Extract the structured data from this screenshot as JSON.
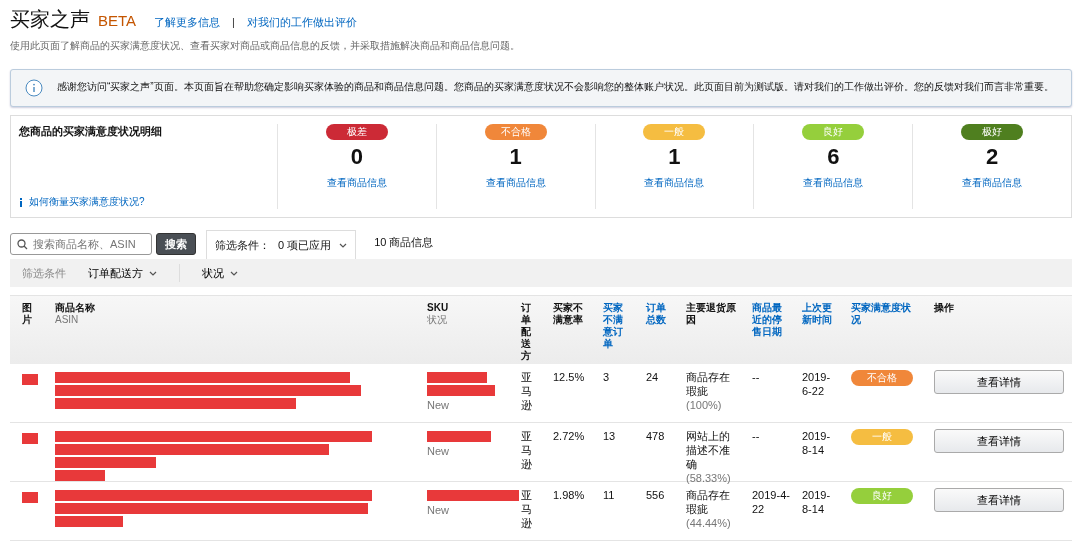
{
  "header": {
    "title": "买家之声",
    "badge": "BETA",
    "links": [
      "了解更多信息",
      "对我们的工作做出评价"
    ],
    "separator": "|",
    "subtitle": "使用此页面了解商品的买家满意度状况、查看买家对商品或商品信息的反馈，并采取措施解决商品和商品信息问题。"
  },
  "notice": {
    "text": "感谢您访问“买家之声”页面。本页面旨在帮助您确定影响买家体验的商品和商品信息问题。您商品的买家满意度状况不会影响您的整体账户状况。此页面目前为测试版。请对我们的工作做出评价。您的反馈对我们而言非常重要。"
  },
  "summary": {
    "title": "您商品的买家满意度状况明细",
    "help_link": "如何衡量买家满意度状况?",
    "levels": [
      {
        "label": "极差",
        "color": "#cc2a36",
        "count": "0",
        "link": "查看商品信息"
      },
      {
        "label": "不合格",
        "color": "#f0873a",
        "count": "1",
        "link": "查看商品信息"
      },
      {
        "label": "一般",
        "color": "#f5bd41",
        "count": "1",
        "link": "查看商品信息"
      },
      {
        "label": "良好",
        "color": "#95cf3c",
        "count": "6",
        "link": "查看商品信息"
      },
      {
        "label": "极好",
        "color": "#4f7f1f",
        "count": "2",
        "link": "查看商品信息"
      }
    ]
  },
  "toolbar": {
    "search_placeholder": "搜索商品名称、ASIN",
    "search_button": "搜索",
    "filter_label": "筛选条件：",
    "filter_value": "0 项已应用",
    "result_count": "10 商品信息"
  },
  "filter_bar": {
    "label": "筛选条件",
    "dropdowns": [
      "订单配送方",
      "状况"
    ]
  },
  "table": {
    "columns": [
      {
        "title": "图片",
        "sortable": false
      },
      {
        "title": "商品名称",
        "subtitle": "ASIN",
        "sortable": false
      },
      {
        "title": "SKU",
        "subtitle": "状况",
        "sortable": false
      },
      {
        "title": "订单配送方",
        "sortable": false
      },
      {
        "title": "买家不满意率",
        "sortable": false
      },
      {
        "title": "买家不满意订单",
        "sortable": true
      },
      {
        "title": "订单总数",
        "sortable": true
      },
      {
        "title": "主要退货原因",
        "sortable": false
      },
      {
        "title": "商品最近的停售日期",
        "sortable": true
      },
      {
        "title": "上次更新时间",
        "sortable": true
      },
      {
        "title": "买家满意度状况",
        "sortable": true
      },
      {
        "title": "操作",
        "sortable": false
      }
    ],
    "rows": [
      {
        "condition": "New",
        "fulfillment": "亚马逊",
        "rate": "12.5%",
        "dissatisfied": "3",
        "total": "24",
        "reason": "商品存在瑕疵",
        "reason_share": "(100%)",
        "stop_date": "--",
        "updated": "2019-6-22",
        "status": {
          "label": "不合格",
          "color": "#f0873a"
        },
        "action": "查看详情"
      },
      {
        "condition": "New",
        "fulfillment": "亚马逊",
        "rate": "2.72%",
        "dissatisfied": "13",
        "total": "478",
        "reason": "网站上的描述不准确",
        "reason_share": "(58.33%)",
        "stop_date": "--",
        "updated": "2019-8-14",
        "status": {
          "label": "一般",
          "color": "#f5bd41"
        },
        "action": "查看详情"
      },
      {
        "condition": "New",
        "fulfillment": "亚马逊",
        "rate": "1.98%",
        "dissatisfied": "11",
        "total": "556",
        "reason": "商品存在瑕疵",
        "reason_share": "(44.44%)",
        "stop_date": "2019-4-22",
        "updated": "2019-8-14",
        "status": {
          "label": "良好",
          "color": "#95cf3c"
        },
        "action": "查看详情"
      }
    ]
  }
}
